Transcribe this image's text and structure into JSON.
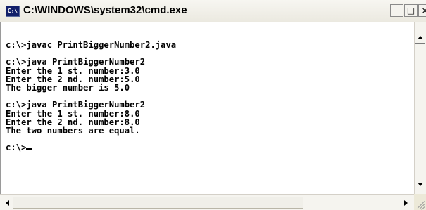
{
  "window": {
    "title": "C:\\WINDOWS\\system32\\cmd.exe",
    "icon_label": "C:\\",
    "buttons": {
      "minimize": "_",
      "maximize": "□",
      "close": "×"
    }
  },
  "console": {
    "lines": [
      "c:\\>javac PrintBiggerNumber2.java",
      "",
      "c:\\>java PrintBiggerNumber2",
      "Enter the 1 st. number:3.0",
      "Enter the 2 nd. number:5.0",
      "The bigger number is 5.0",
      "",
      "c:\\>java PrintBiggerNumber2",
      "Enter the 1 st. number:8.0",
      "Enter the 2 nd. number:8.0",
      "The two numbers are equal.",
      "",
      "c:\\>"
    ]
  }
}
